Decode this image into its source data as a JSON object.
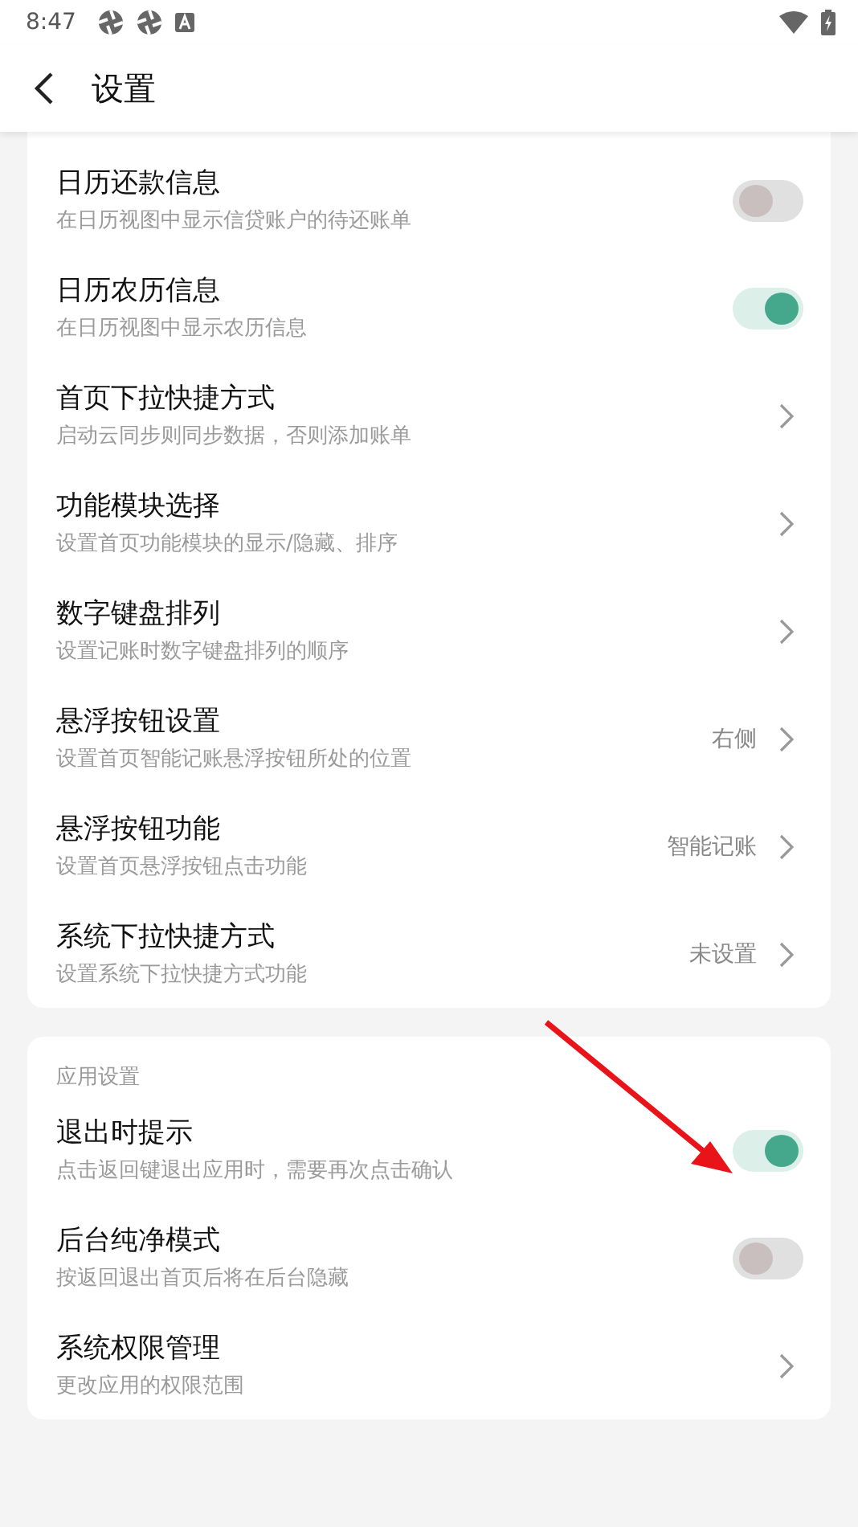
{
  "status_bar": {
    "time": "8:47"
  },
  "header": {
    "title": "设置"
  },
  "sections": [
    {
      "items": [
        {
          "kind": "toggle",
          "title": "日历还款信息",
          "subtitle": "在日历视图中显示信贷账户的待还账单",
          "on": false
        },
        {
          "kind": "toggle",
          "title": "日历农历信息",
          "subtitle": "在日历视图中显示农历信息",
          "on": true
        },
        {
          "kind": "link",
          "title": "首页下拉快捷方式",
          "subtitle": "启动云同步则同步数据，否则添加账单"
        },
        {
          "kind": "link",
          "title": "功能模块选择",
          "subtitle": "设置首页功能模块的显示/隐藏、排序"
        },
        {
          "kind": "link",
          "title": "数字键盘排列",
          "subtitle": "设置记账时数字键盘排列的顺序"
        },
        {
          "kind": "link",
          "title": "悬浮按钮设置",
          "subtitle": "设置首页智能记账悬浮按钮所处的位置",
          "value": "右侧"
        },
        {
          "kind": "link",
          "title": "悬浮按钮功能",
          "subtitle": "设置首页悬浮按钮点击功能",
          "value": "智能记账"
        },
        {
          "kind": "link",
          "title": "系统下拉快捷方式",
          "subtitle": "设置系统下拉快捷方式功能",
          "value": "未设置"
        }
      ]
    },
    {
      "title": "应用设置",
      "items": [
        {
          "kind": "toggle",
          "title": "退出时提示",
          "subtitle": "点击返回键退出应用时，需要再次点击确认",
          "on": true
        },
        {
          "kind": "toggle",
          "title": "后台纯净模式",
          "subtitle": "按返回退出首页后将在后台隐藏",
          "on": false
        },
        {
          "kind": "link",
          "title": "系统权限管理",
          "subtitle": "更改应用的权限范围"
        }
      ]
    }
  ]
}
